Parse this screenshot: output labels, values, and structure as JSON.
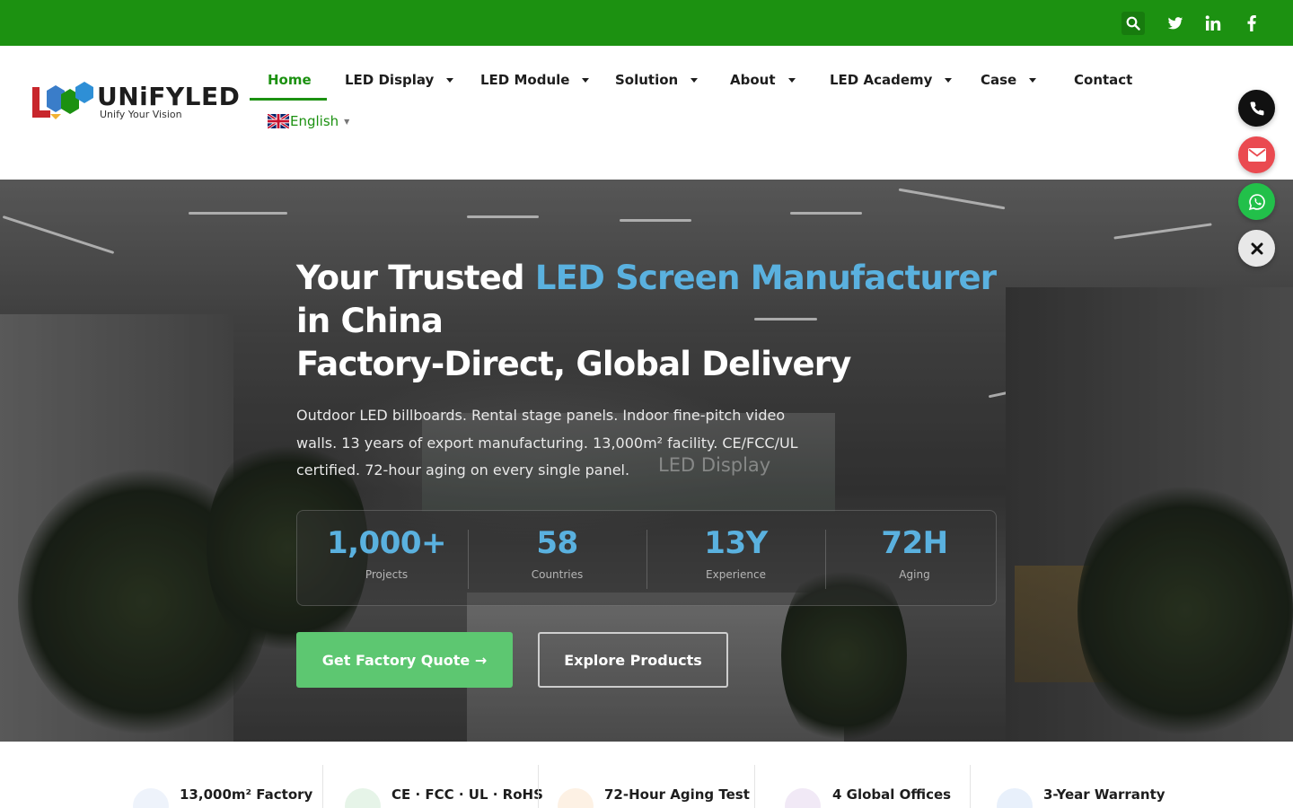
{
  "topbar": {
    "icons": [
      "search-icon",
      "twitter-icon",
      "linkedin-icon",
      "facebook-icon"
    ],
    "color": "#1c9111"
  },
  "header": {
    "brand": "UNiFYLED",
    "tagline": "Unify Your Vision",
    "nav": [
      {
        "label": "Home",
        "active": true,
        "dropdown": false
      },
      {
        "label": "LED Display",
        "active": false,
        "dropdown": true
      },
      {
        "label": "LED Module",
        "active": false,
        "dropdown": true
      },
      {
        "label": "Solution",
        "active": false,
        "dropdown": true
      },
      {
        "label": "About",
        "active": false,
        "dropdown": true
      },
      {
        "label": "LED Academy",
        "active": false,
        "dropdown": true
      },
      {
        "label": "Case",
        "active": false,
        "dropdown": true
      },
      {
        "label": "Contact",
        "active": false,
        "dropdown": false
      }
    ],
    "language": "English"
  },
  "hero": {
    "title_part1": "Your Trusted ",
    "title_highlight": "LED Screen Manufacturer",
    "title_part2": " in China",
    "title_line2": "Factory-Direct, Global Delivery",
    "subtitle": "Outdoor LED billboards. Rental stage panels. Indoor fine-pitch video walls. 13 years of export manufacturing. 13,000m² facility. CE/FCC/UL certified. 72-hour aging on every single panel.",
    "background_sign": "LED Display",
    "stats": [
      {
        "value": "1,000+",
        "label": "Projects"
      },
      {
        "value": "58",
        "label": "Countries"
      },
      {
        "value": "13Y",
        "label": "Experience"
      },
      {
        "value": "72H",
        "label": "Aging"
      }
    ],
    "primary_button": "Get Factory Quote →",
    "secondary_button": "Explore Products",
    "accent_color": "#5ab1df",
    "button_color": "#5dc771"
  },
  "floating_contact": [
    "phone-icon",
    "email-icon",
    "whatsapp-icon",
    "close-icon"
  ],
  "features": [
    {
      "label": "13,000m² Factory",
      "icon": "factory-icon"
    },
    {
      "label": "CE · FCC · UL · RoHS",
      "icon": "certificate-check-icon"
    },
    {
      "label": "72-Hour Aging Test",
      "icon": "test-tube-icon"
    },
    {
      "label": "4 Global Offices",
      "icon": "globe-icon"
    },
    {
      "label": "3-Year Warranty",
      "icon": "shield-icon"
    }
  ]
}
